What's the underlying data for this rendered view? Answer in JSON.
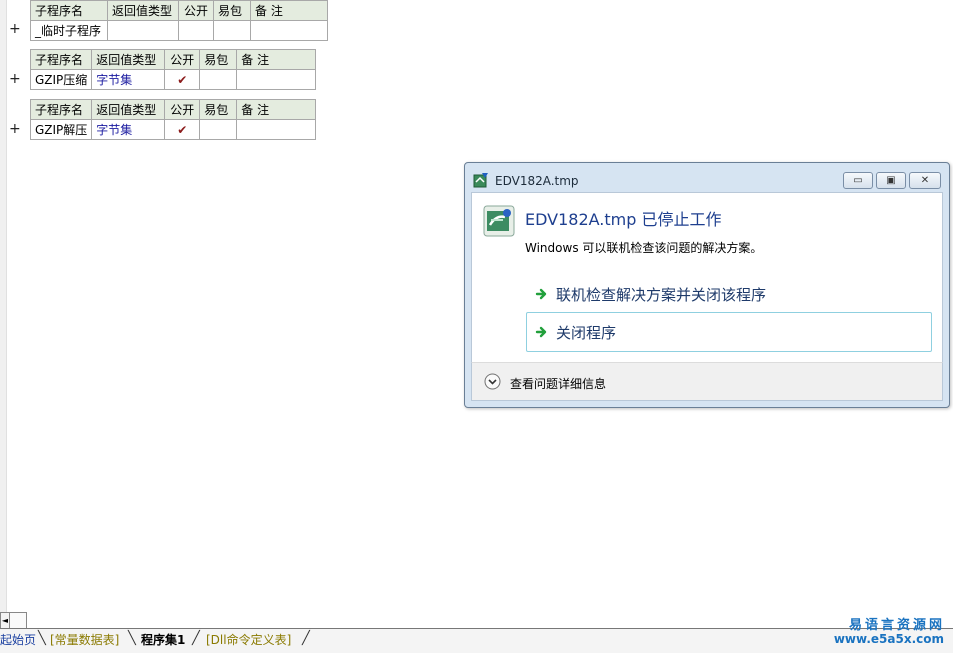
{
  "headers": {
    "name": "子程序名",
    "ret": "返回值类型",
    "pub": "公开",
    "easy": "易包",
    "note": "备 注"
  },
  "subs": [
    {
      "name": "_临时子程序",
      "ret": "",
      "pub": ""
    },
    {
      "name": "GZIP压缩",
      "ret": "字节集",
      "pub": "✔"
    },
    {
      "name": "GZIP解压",
      "ret": "字节集",
      "pub": "✔"
    }
  ],
  "plus_symbol": "+",
  "dialog": {
    "title": "EDV182A.tmp",
    "main_message": "EDV182A.tmp 已停止工作",
    "sub_message": "Windows 可以联机检查该问题的解决方案。",
    "option_check_online": "联机检查解决方案并关闭该程序",
    "option_close": "关闭程序",
    "details_label": "查看问题详细信息",
    "minimize_glyph": "▭",
    "maximize_glyph": "▣",
    "close_glyph": "✕"
  },
  "tabs": {
    "start": "起始页",
    "constants": "[常量数据表]",
    "program_set": "程序集1",
    "dll_commands": "[Dll命令定义表]"
  },
  "watermark": {
    "line1": "易语言资源网",
    "line2": "www.e5a5x.com"
  },
  "scroll_left_glyph": "◄",
  "colors": {
    "header_bg": "#e4ecdf",
    "value_blue": "#1a1aa0",
    "check_red": "#8b1a1a",
    "dialog_frame": "#d6e4f2",
    "main_message_blue": "#1e3f8f",
    "arrow_green": "#22a03c",
    "watermark_blue": "#1a73c0"
  },
  "icons": [
    "app-error-icon",
    "green-arrow-icon",
    "chevron-down-icon",
    "minimize-icon",
    "maximize-icon",
    "close-icon"
  ]
}
